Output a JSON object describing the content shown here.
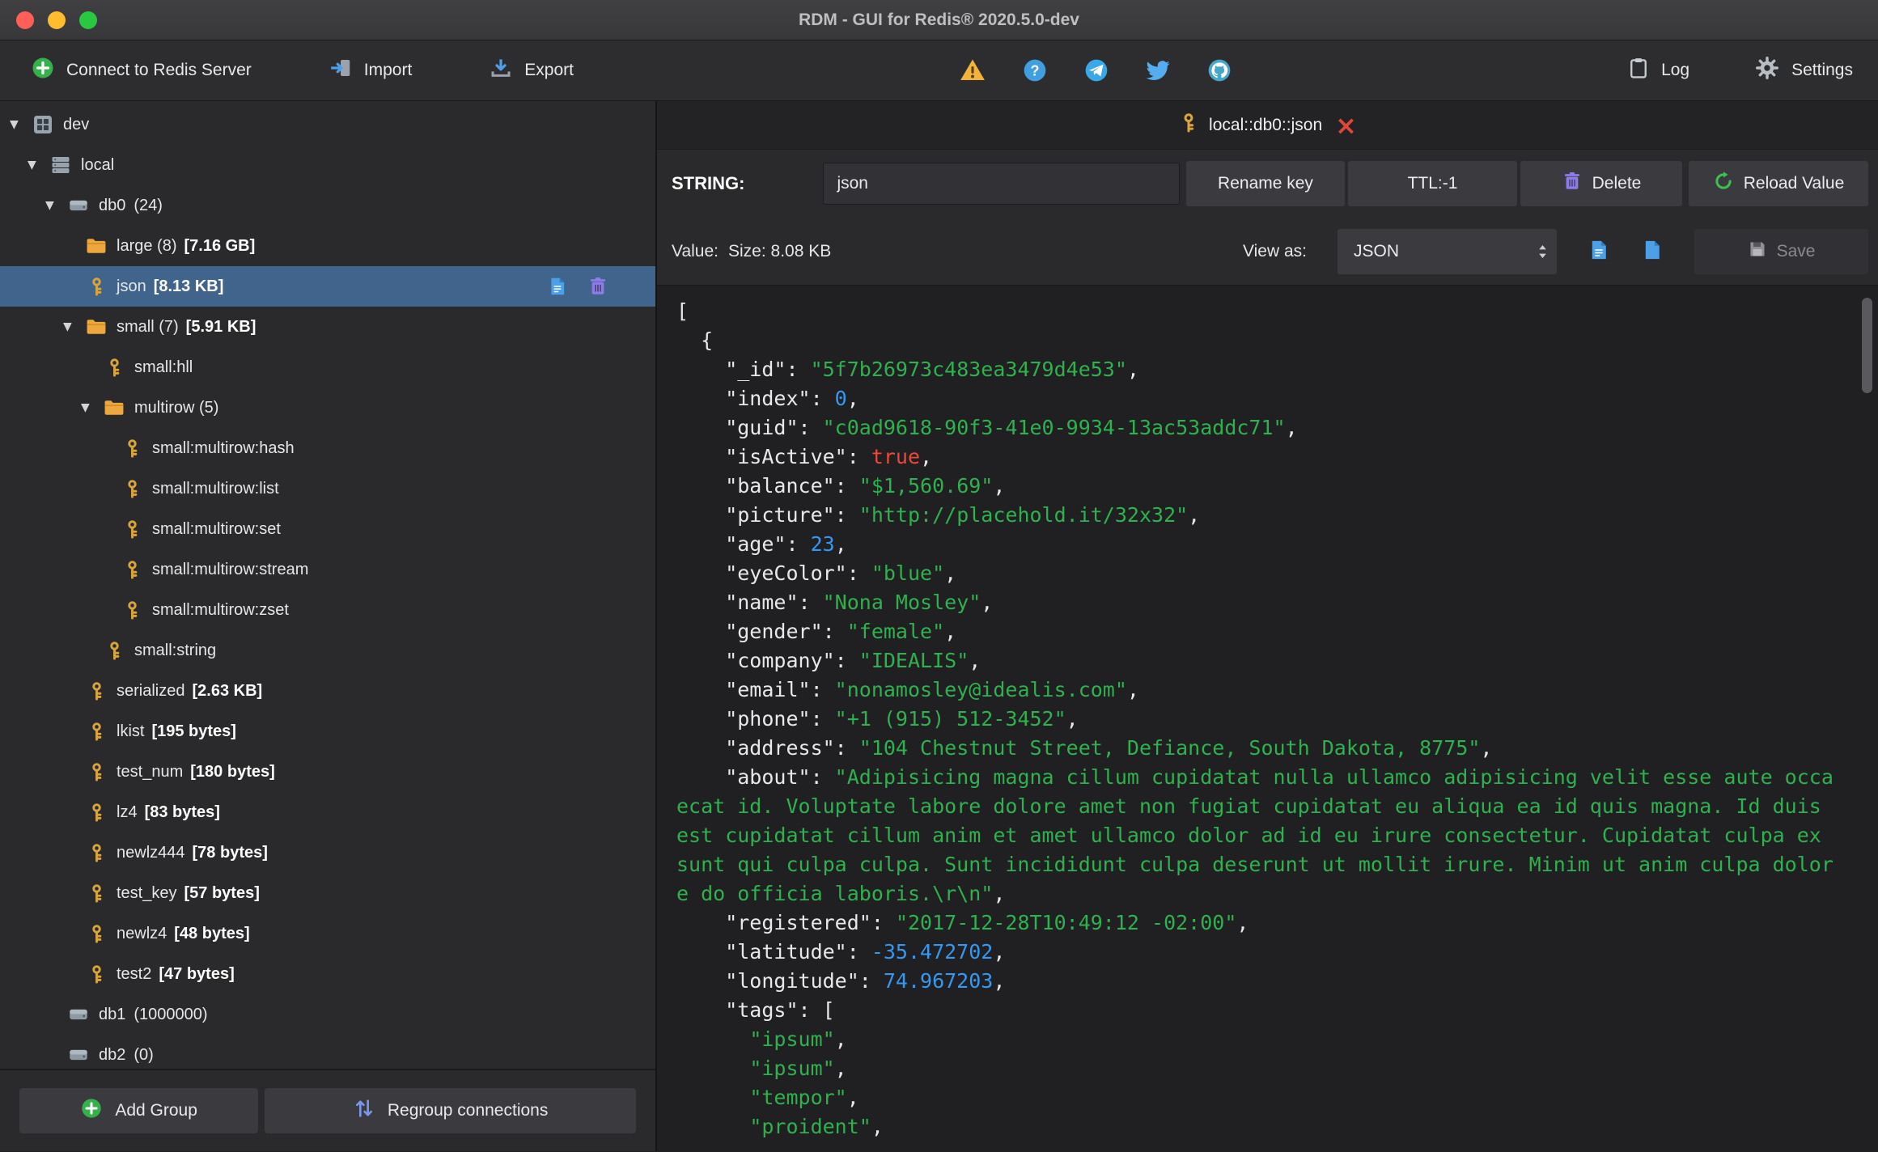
{
  "window": {
    "title": "RDM - GUI for Redis® 2020.5.0-dev"
  },
  "toolbar": {
    "connect_label": "Connect to Redis Server",
    "import_label": "Import",
    "export_label": "Export",
    "log_label": "Log",
    "settings_label": "Settings"
  },
  "sidebar": {
    "tree": [
      {
        "label": "dev",
        "icon": "connection-icon",
        "level": 0,
        "expanded": true
      },
      {
        "label": "local",
        "icon": "server-icon",
        "level": 1,
        "expanded": true
      },
      {
        "label": "db0",
        "count": "(24)",
        "icon": "database-icon",
        "level": 2,
        "expanded": true
      },
      {
        "label": "large (8)",
        "size": "[7.16 GB]",
        "icon": "folder-icon",
        "level": 3
      },
      {
        "label": "json",
        "size": "[8.13 KB]",
        "icon": "key-icon",
        "level": 3,
        "selected": true,
        "actions": true
      },
      {
        "label": "small (7)",
        "size": "[5.91 KB]",
        "icon": "folder-icon",
        "level": 3,
        "expanded": true
      },
      {
        "label": "small:hll",
        "icon": "key-icon",
        "level": 4
      },
      {
        "label": "multirow (5)",
        "icon": "folder-icon",
        "level": 4,
        "expanded": true
      },
      {
        "label": "small:multirow:hash",
        "icon": "key-icon",
        "level": 5
      },
      {
        "label": "small:multirow:list",
        "icon": "key-icon",
        "level": 5
      },
      {
        "label": "small:multirow:set",
        "icon": "key-icon",
        "level": 5
      },
      {
        "label": "small:multirow:stream",
        "icon": "key-icon",
        "level": 5
      },
      {
        "label": "small:multirow:zset",
        "icon": "key-icon",
        "level": 5
      },
      {
        "label": "small:string",
        "icon": "key-icon",
        "level": 4
      },
      {
        "label": "serialized",
        "size": "[2.63 KB]",
        "icon": "key-icon",
        "level": 3
      },
      {
        "label": "lkist",
        "size": "[195 bytes]",
        "icon": "key-icon",
        "level": 3
      },
      {
        "label": "test_num",
        "size": "[180 bytes]",
        "icon": "key-icon",
        "level": 3
      },
      {
        "label": "lz4",
        "size": "[83 bytes]",
        "icon": "key-icon",
        "level": 3
      },
      {
        "label": "newlz444",
        "size": "[78 bytes]",
        "icon": "key-icon",
        "level": 3
      },
      {
        "label": "test_key",
        "size": "[57 bytes]",
        "icon": "key-icon",
        "level": 3
      },
      {
        "label": "newlz4",
        "size": "[48 bytes]",
        "icon": "key-icon",
        "level": 3
      },
      {
        "label": "test2",
        "size": "[47 bytes]",
        "icon": "key-icon",
        "level": 3
      },
      {
        "label": "db1",
        "count": "(1000000)",
        "icon": "database-icon",
        "level": 2
      },
      {
        "label": "db2",
        "count": "(0)",
        "icon": "database-icon",
        "level": 2
      }
    ],
    "add_group_label": "Add Group",
    "regroup_label": "Regroup connections"
  },
  "main": {
    "tab": {
      "title": "local::db0::json"
    },
    "key_row": {
      "type_label": "STRING:",
      "key_value": "json",
      "rename_label": "Rename key",
      "ttl_label": "TTL:-1",
      "delete_label": "Delete",
      "reload_label": "Reload Value"
    },
    "value_row": {
      "value_label": "Value:",
      "size_label": "Size: 8.08 KB",
      "view_as_label": "View as:",
      "view_mode": "JSON",
      "save_label": "Save"
    },
    "editor": {
      "lines": [
        [
          [
            "p",
            "["
          ]
        ],
        [
          [
            "p",
            "  {"
          ]
        ],
        [
          [
            "p",
            "    \"_id\": "
          ],
          [
            "s",
            "\"5f7b26973c483ea3479d4e53\""
          ],
          [
            "p",
            ","
          ]
        ],
        [
          [
            "p",
            "    \"index\": "
          ],
          [
            "n",
            "0"
          ],
          [
            "p",
            ","
          ]
        ],
        [
          [
            "p",
            "    \"guid\": "
          ],
          [
            "s",
            "\"c0ad9618-90f3-41e0-9934-13ac53addc71\""
          ],
          [
            "p",
            ","
          ]
        ],
        [
          [
            "p",
            "    \"isActive\": "
          ],
          [
            "b",
            "true"
          ],
          [
            "p",
            ","
          ]
        ],
        [
          [
            "p",
            "    \"balance\": "
          ],
          [
            "s",
            "\"$1,560.69\""
          ],
          [
            "p",
            ","
          ]
        ],
        [
          [
            "p",
            "    \"picture\": "
          ],
          [
            "s",
            "\"http://placehold.it/32x32\""
          ],
          [
            "p",
            ","
          ]
        ],
        [
          [
            "p",
            "    \"age\": "
          ],
          [
            "n",
            "23"
          ],
          [
            "p",
            ","
          ]
        ],
        [
          [
            "p",
            "    \"eyeColor\": "
          ],
          [
            "s",
            "\"blue\""
          ],
          [
            "p",
            ","
          ]
        ],
        [
          [
            "p",
            "    \"name\": "
          ],
          [
            "s",
            "\"Nona Mosley\""
          ],
          [
            "p",
            ","
          ]
        ],
        [
          [
            "p",
            "    \"gender\": "
          ],
          [
            "s",
            "\"female\""
          ],
          [
            "p",
            ","
          ]
        ],
        [
          [
            "p",
            "    \"company\": "
          ],
          [
            "s",
            "\"IDEALIS\""
          ],
          [
            "p",
            ","
          ]
        ],
        [
          [
            "p",
            "    \"email\": "
          ],
          [
            "s",
            "\"nonamosley@idealis.com\""
          ],
          [
            "p",
            ","
          ]
        ],
        [
          [
            "p",
            "    \"phone\": "
          ],
          [
            "s",
            "\"+1 (915) 512-3452\""
          ],
          [
            "p",
            ","
          ]
        ],
        [
          [
            "p",
            "    \"address\": "
          ],
          [
            "s",
            "\"104 Chestnut Street, Defiance, South Dakota, 8775\""
          ],
          [
            "p",
            ","
          ]
        ],
        [
          [
            "p",
            "    \"about\": "
          ],
          [
            "s",
            "\"Adipisicing magna cillum cupidatat nulla ullamco adipisicing velit esse aute occa"
          ]
        ],
        [
          [
            "s",
            "ecat id. Voluptate labore dolore amet non fugiat cupidatat eu aliqua ea id quis magna. Id duis "
          ]
        ],
        [
          [
            "s",
            "est cupidatat cillum anim et amet ullamco dolor ad id eu irure consectetur. Cupidatat culpa ex "
          ]
        ],
        [
          [
            "s",
            "sunt qui culpa culpa. Sunt incididunt culpa deserunt ut mollit irure. Minim ut anim culpa dolor"
          ]
        ],
        [
          [
            "s",
            "e do officia laboris.\\r\\n\""
          ],
          [
            "p",
            ","
          ]
        ],
        [
          [
            "p",
            "    \"registered\": "
          ],
          [
            "s",
            "\"2017-12-28T10:49:12 -02:00\""
          ],
          [
            "p",
            ","
          ]
        ],
        [
          [
            "p",
            "    \"latitude\": "
          ],
          [
            "n",
            "-35.472702"
          ],
          [
            "p",
            ","
          ]
        ],
        [
          [
            "p",
            "    \"longitude\": "
          ],
          [
            "n",
            "74.967203"
          ],
          [
            "p",
            ","
          ]
        ],
        [
          [
            "p",
            "    \"tags\": ["
          ]
        ],
        [
          [
            "p",
            "      "
          ],
          [
            "s",
            "\"ipsum\""
          ],
          [
            "p",
            ","
          ]
        ],
        [
          [
            "p",
            "      "
          ],
          [
            "s",
            "\"ipsum\""
          ],
          [
            "p",
            ","
          ]
        ],
        [
          [
            "p",
            "      "
          ],
          [
            "s",
            "\"tempor\""
          ],
          [
            "p",
            ","
          ]
        ],
        [
          [
            "p",
            "      "
          ],
          [
            "s",
            "\"proident\""
          ],
          [
            "p",
            ","
          ]
        ]
      ]
    }
  },
  "icons": {
    "warning-icon": "triangle-!",
    "help-icon": "?-circle",
    "telegram-icon": "paper-plane-circle",
    "twitter-icon": "bird",
    "github-icon": "octocat-circle",
    "log-icon": "clipboard",
    "gear-icon": "gear",
    "key-icon": "key",
    "folder-icon": "folder",
    "database-icon": "disk",
    "server-icon": "server-stack",
    "connection-icon": "grid-square",
    "trash-icon": "trash",
    "edit-value-icon": "document",
    "reload-icon": "circular-arrow",
    "save-icon": "floppy",
    "add-icon": "plus-circle",
    "regroup-icon": "up-down-arrows",
    "close-icon": "×",
    "chevron-updown-icon": "up-down-chevrons"
  },
  "colors": {
    "selection_blue": "#41648c",
    "json_string_green": "#2eb14e",
    "json_number_blue": "#3598f2",
    "json_keyword_red": "#ef4836",
    "key_gold": "#d9a43c",
    "folder_orange": "#eda73c",
    "delete_purple": "#8d7ce8",
    "doc_blue": "#4da0e8",
    "reload_green": "#3fbf4f",
    "connect_green": "#35b14b"
  }
}
